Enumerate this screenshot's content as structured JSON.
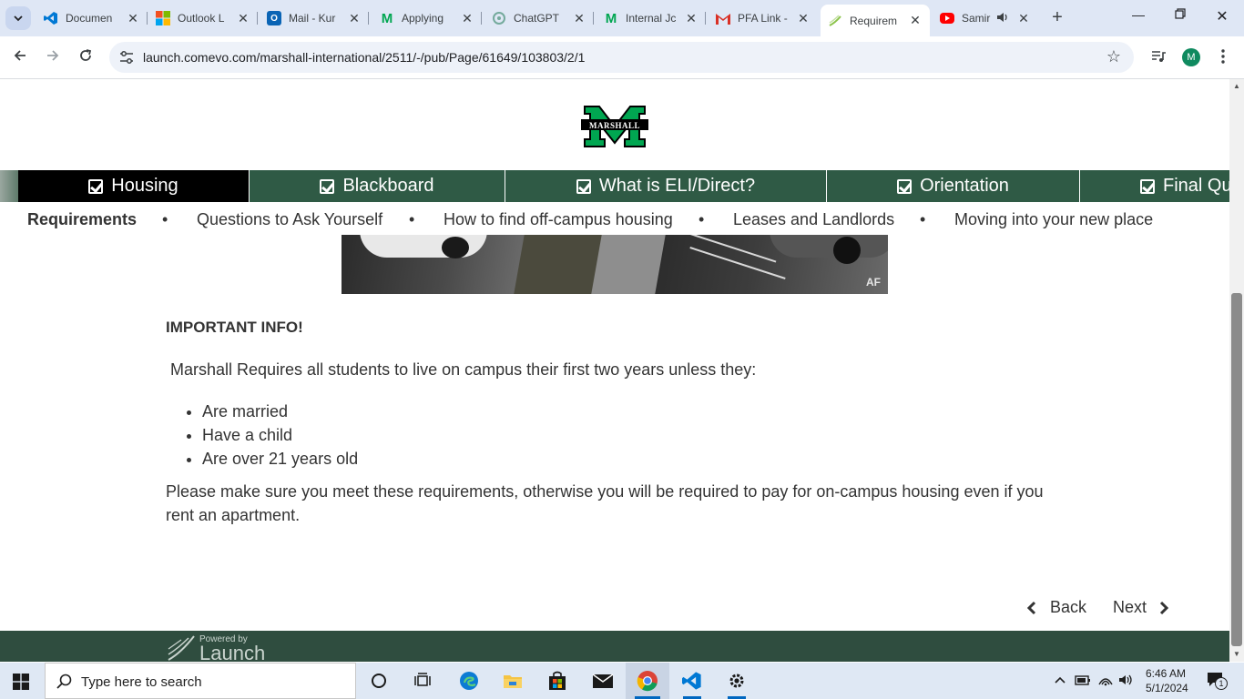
{
  "browser": {
    "tabs": [
      {
        "title": "Documen",
        "icon": "vscode-icon",
        "color": "#0078d4"
      },
      {
        "title": "Outlook L",
        "icon": "microsoft-icon",
        "color": "#f25022"
      },
      {
        "title": "Mail - Kur",
        "icon": "outlook-icon",
        "color": "#0a64b5"
      },
      {
        "title": "Applying",
        "icon": "marshall-icon",
        "color": "#00a651"
      },
      {
        "title": "ChatGPT",
        "icon": "chatgpt-icon",
        "color": "#74aa9c"
      },
      {
        "title": "Internal Jc",
        "icon": "marshall-icon",
        "color": "#00a651"
      },
      {
        "title": "PFA Link -",
        "icon": "gmail-icon",
        "color": "#d93025"
      },
      {
        "title": "Requirem",
        "icon": "launch-icon",
        "color": "#8bc34a"
      },
      {
        "title": "Samir",
        "icon": "youtube-icon",
        "color": "#ff0000"
      }
    ],
    "url": "launch.comevo.com/marshall-international/2511/-/pub/Page/61649/103803/2/1",
    "avatar_letter": "M"
  },
  "page": {
    "logo_text": "MARSHALL",
    "nav": [
      {
        "label": "Housing"
      },
      {
        "label": "Blackboard"
      },
      {
        "label": "What is ELI/Direct?"
      },
      {
        "label": "Orientation"
      },
      {
        "label": "Final Qu"
      }
    ],
    "subnav": [
      "Requirements",
      "Questions to Ask Yourself",
      "How to find off-campus housing",
      "Leases and Landlords",
      "Moving into your new place"
    ],
    "subnav_sep": "•",
    "photo_watermark": "AF",
    "important": "IMPORTANT INFO!",
    "intro": " Marshall Requires all students to live on campus their first two years unless they:",
    "list": [
      "Are married",
      "Have a child",
      "Are over 21 years old"
    ],
    "closing": "Please make sure you meet these requirements, otherwise you will be required to pay for on-campus housing even if you rent an apartment.",
    "back": "Back",
    "next": "Next",
    "powered_by": "Powered by",
    "launch": "Launch"
  },
  "taskbar": {
    "search_placeholder": "Type here to search",
    "time": "6:46 AM",
    "date": "5/1/2024",
    "notification_count": "1"
  }
}
